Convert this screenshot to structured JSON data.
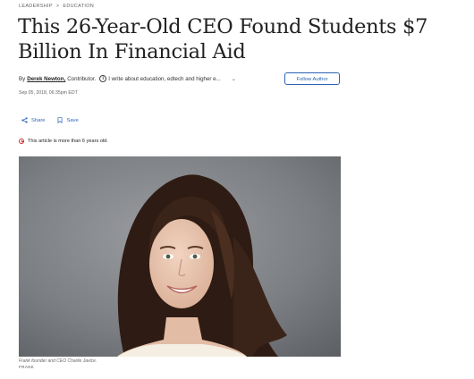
{
  "breadcrumb": {
    "items": [
      "LEADERSHIP",
      "EDUCATION"
    ],
    "separator": ">"
  },
  "article": {
    "headline": "This 26-Year-Old CEO Found Students $7 Billion In Financial Aid",
    "byline": {
      "prefix": "By",
      "author": "Derek Newton,",
      "role": "Contributor.",
      "bio": "I write about education, edtech and higher e...",
      "info_icon": "info-icon",
      "expand_icon": "chevron-down-icon"
    },
    "follow_label": "Follow Author",
    "date": "Sep 05, 2018, 06:35pm EDT",
    "share_label": "Share",
    "save_label": "Save",
    "age_notice": "This article is more than 6 years old.",
    "image_caption": "Frank founder and CEO Charlie Javice.",
    "image_credit": "FRANK"
  },
  "colors": {
    "accent": "#2b64b6",
    "notice": "#c62828",
    "text": "#222222"
  }
}
